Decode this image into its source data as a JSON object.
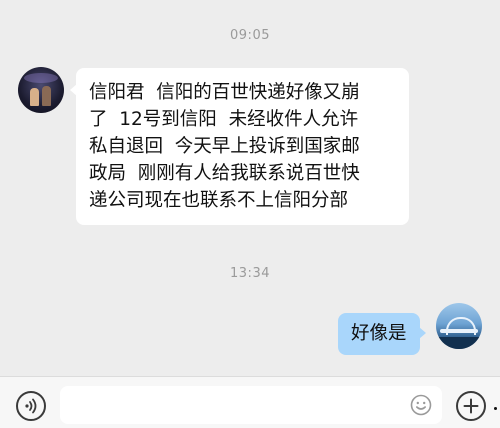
{
  "chat": {
    "timestamps": [
      "09:05",
      "13:34"
    ],
    "messages": [
      {
        "side": "left",
        "text": "信阳君  信阳的百世快递好像又崩\n了  12号到信阳  未经收件人允许\n私自退回  今天早上投诉到国家邮\n政局  刚刚有人给我联系说百世快\n递公司现在也联系不上信阳分部"
      },
      {
        "side": "right",
        "text": "好像是"
      }
    ]
  },
  "input_bar": {
    "message_value": "",
    "icons": [
      "voice-icon",
      "emoji-icon",
      "plus-icon"
    ]
  },
  "colors": {
    "chat_background": "#ededed",
    "received_bubble": "#ffffff",
    "sent_bubble": "#a9d6fb",
    "input_bar": "#f7f7f7"
  }
}
